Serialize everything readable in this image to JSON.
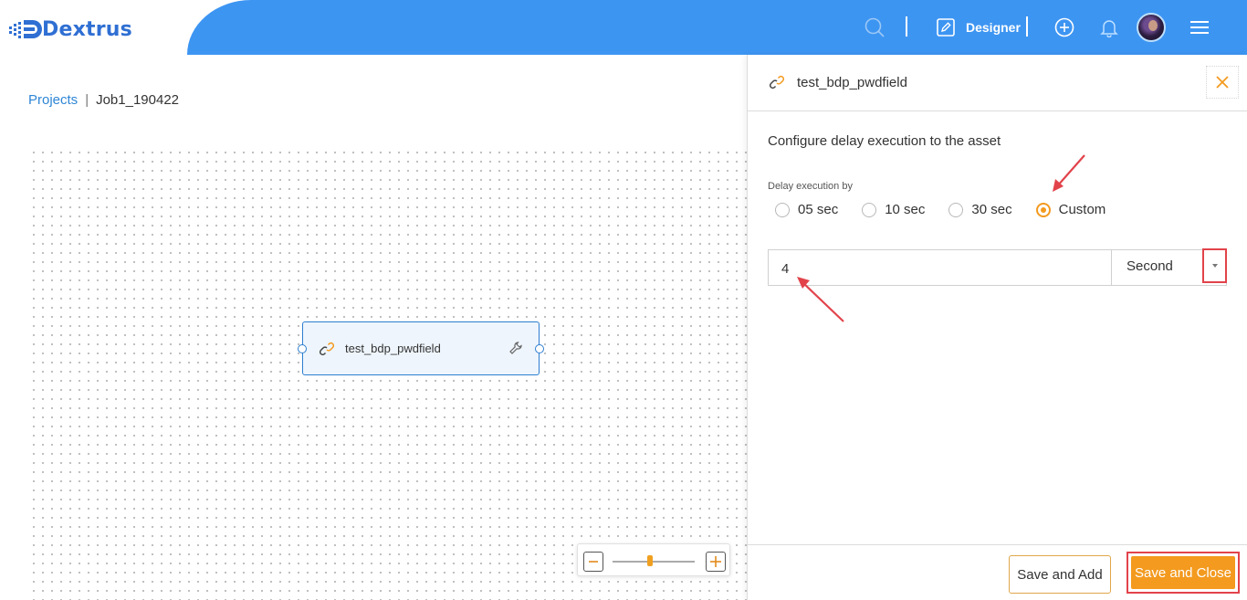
{
  "app": {
    "name": "Dextrus"
  },
  "header": {
    "mode_label": "Designer"
  },
  "breadcrumb": {
    "root": "Projects",
    "separator": "|",
    "current": "Job1_190422"
  },
  "canvas": {
    "node": {
      "label": "test_bdp_pwdfield"
    }
  },
  "panel": {
    "title": "test_bdp_pwdfield",
    "section_title": "Configure delay execution to the asset",
    "delay_label": "Delay execution by",
    "options": [
      {
        "label": "05 sec",
        "selected": false
      },
      {
        "label": "10 sec",
        "selected": false
      },
      {
        "label": "30 sec",
        "selected": false
      },
      {
        "label": "Custom",
        "selected": true
      }
    ],
    "custom_value": "4",
    "unit": "Second",
    "buttons": {
      "save_add": "Save and Add",
      "save_close": "Save and Close"
    }
  },
  "colors": {
    "header_blue": "#3d95f2",
    "accent_orange": "#f39a1f",
    "highlight_red": "#e2434b",
    "link_blue": "#2f86d6"
  },
  "icons": [
    "search-icon",
    "designer-edit-icon",
    "add-circle-icon",
    "bell-icon",
    "menu-icon",
    "link-icon",
    "wrench-icon",
    "close-icon",
    "zoom-out-icon",
    "zoom-in-icon"
  ]
}
